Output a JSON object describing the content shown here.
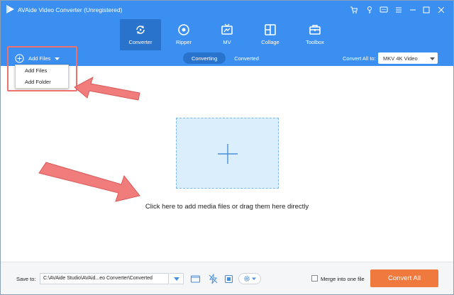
{
  "window": {
    "title": "AVAide Video Converter (Unregistered)",
    "accent_color": "#3a8ff0",
    "controls": [
      "cart-icon",
      "key-icon",
      "feedback-icon",
      "menu-icon",
      "minimize-icon",
      "maximize-icon",
      "close-icon"
    ]
  },
  "tabs": [
    {
      "label": "Converter",
      "icon": "converter-icon",
      "active": true
    },
    {
      "label": "Ripper",
      "icon": "ripper-disc-icon",
      "active": false
    },
    {
      "label": "MV",
      "icon": "mv-tv-icon",
      "active": false
    },
    {
      "label": "Collage",
      "icon": "collage-grid-icon",
      "active": false
    },
    {
      "label": "Toolbox",
      "icon": "toolbox-icon",
      "active": false
    }
  ],
  "toolbar": {
    "add_files_label": "Add Files",
    "segments": [
      {
        "label": "Converting",
        "active": true
      },
      {
        "label": "Converted",
        "active": false
      }
    ],
    "convert_all_to_label": "Convert All to:",
    "format_value": "MKV 4K Video"
  },
  "add_files_menu": {
    "items": [
      "Add Files",
      "Add Folder"
    ]
  },
  "main": {
    "drop_hint": "Click here to add media files or drag them here directly"
  },
  "bottom": {
    "save_to_label": "Save to:",
    "save_path": "C:\\AVAide Studio\\AVAid...eo Converter\\Converted",
    "merge_label": "Merge into one file",
    "merge_checked": false,
    "convert_all_button": "Convert All",
    "button_color": "#f07a3e"
  }
}
